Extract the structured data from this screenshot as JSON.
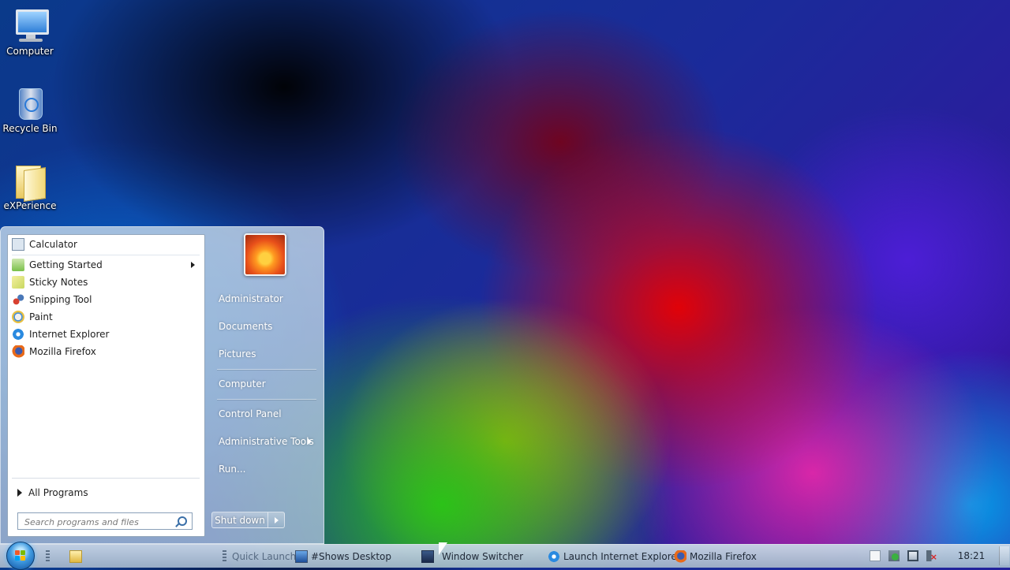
{
  "desktop": {
    "icons": [
      {
        "label": "Computer",
        "icon": "computer-icon"
      },
      {
        "label": "Recycle Bin",
        "icon": "recycle-bin-icon"
      },
      {
        "label": "eXPerience",
        "icon": "folder-icon"
      }
    ]
  },
  "start_menu": {
    "programs": [
      {
        "label": "Calculator",
        "icon": "calculator-icon",
        "color": "#8aa8c8"
      },
      {
        "label": "Getting Started",
        "icon": "getting-started-icon",
        "color": "#7ac04a",
        "has_submenu": true
      },
      {
        "label": "Sticky Notes",
        "icon": "sticky-notes-icon",
        "color": "#e8e070"
      },
      {
        "label": "Snipping Tool",
        "icon": "scissors-icon",
        "color": "#d84030"
      },
      {
        "label": "Paint",
        "icon": "paint-icon",
        "color": "#4a90d8"
      },
      {
        "label": "Internet Explorer",
        "icon": "internet-explorer-icon",
        "color": "#2a8ae0"
      },
      {
        "label": "Mozilla Firefox",
        "icon": "firefox-icon",
        "color": "#e86a1a"
      }
    ],
    "all_programs": "All Programs",
    "search": {
      "placeholder": "Search programs and files"
    },
    "places": [
      {
        "label": "Administrator"
      },
      {
        "label": "Documents"
      },
      {
        "label": "Pictures"
      },
      {
        "label": "Computer"
      },
      {
        "label": "Control Panel"
      },
      {
        "label": "Administrative Tools",
        "has_submenu": true
      },
      {
        "label": "Run..."
      }
    ],
    "shutdown": "Shut down"
  },
  "taskbar": {
    "quick_launch": "Quick Launch",
    "items": [
      {
        "label": "#Shows Desktop",
        "icon": "show-desktop-icon"
      },
      {
        "label": "Window Switcher",
        "icon": "window-switcher-icon"
      },
      {
        "label": "Launch Internet Explore...",
        "icon": "internet-explorer-icon"
      },
      {
        "label": "Mozilla Firefox",
        "icon": "firefox-icon"
      }
    ],
    "clock": "18:21"
  },
  "colors": {
    "start_orb": "#3f9ae0",
    "taskbar": "#b4c6d8",
    "menu_text": "#1e1e1e"
  }
}
